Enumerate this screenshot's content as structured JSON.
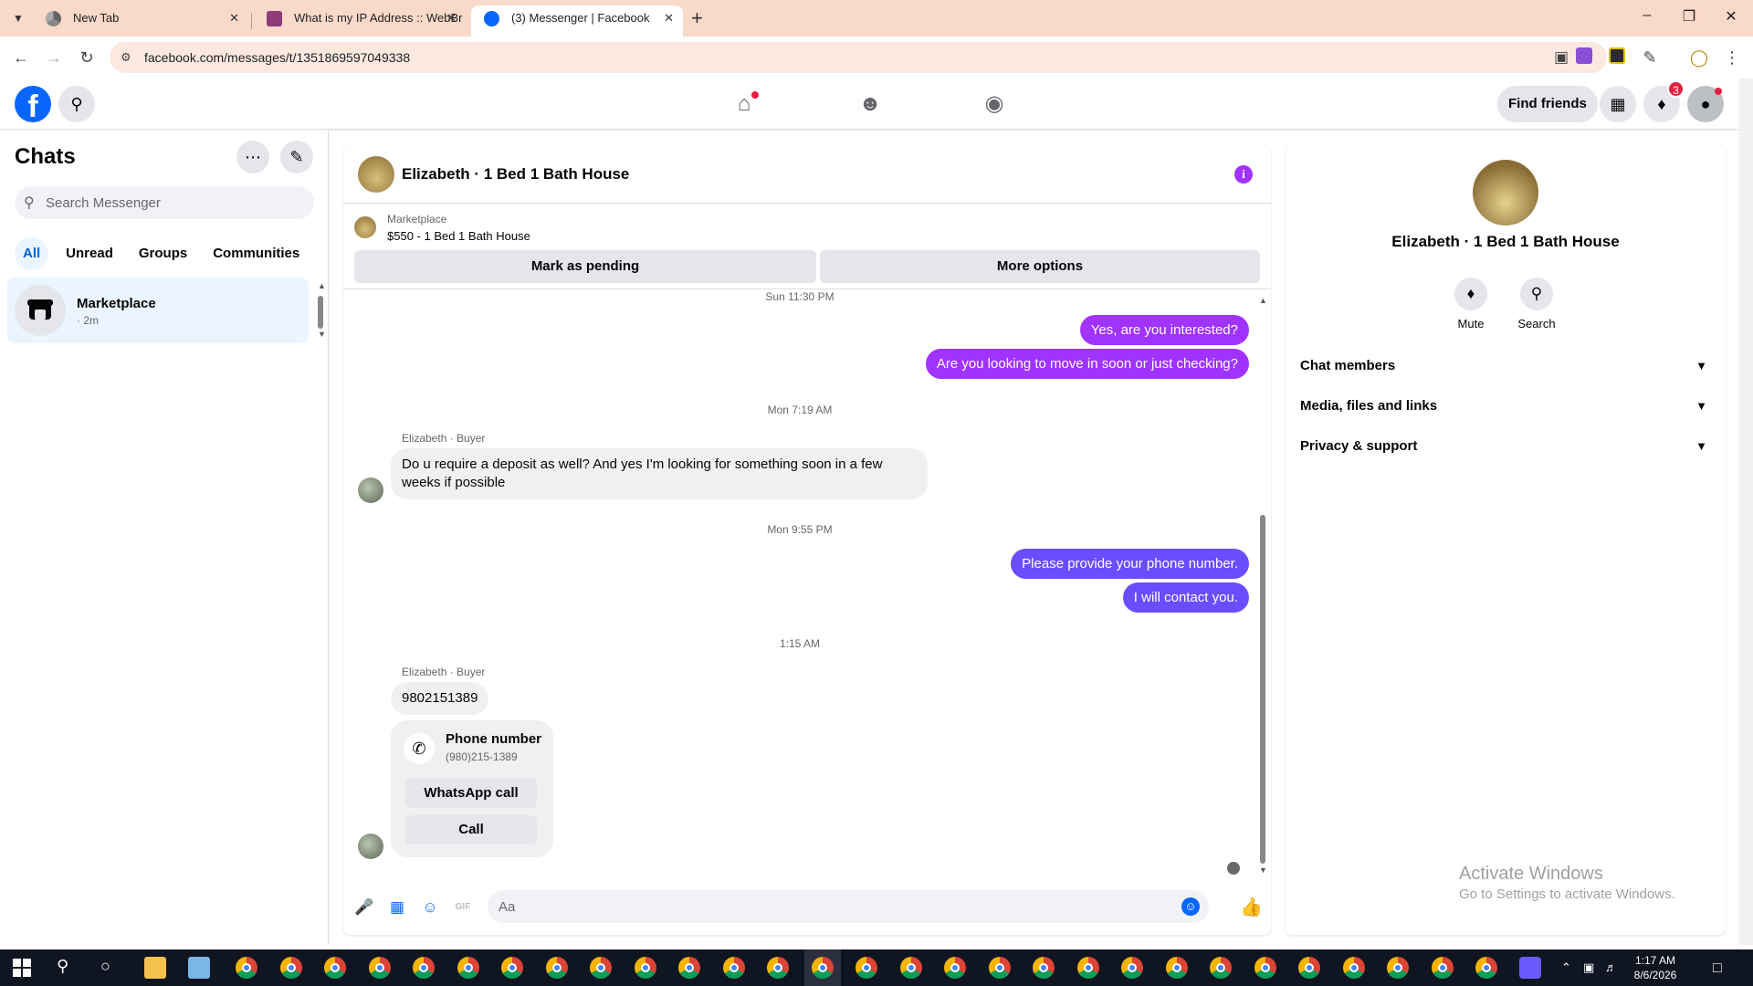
{
  "browser": {
    "tabs": [
      {
        "title": "New Tab",
        "active": false
      },
      {
        "title": "What is my IP Address :: WebBr",
        "active": false
      },
      {
        "title": "(3) Messenger | Facebook",
        "active": true
      }
    ],
    "url": "facebook.com/messages/t/1351869597049338"
  },
  "fb_nav": {
    "find_friends": "Find friends",
    "notifications_count": "3"
  },
  "chats": {
    "title": "Chats",
    "search_placeholder": "Search Messenger",
    "filters": [
      "All",
      "Unread",
      "Groups",
      "Communities"
    ],
    "items": [
      {
        "name": "Marketplace",
        "time": "· 2m"
      }
    ]
  },
  "conversation": {
    "title": "Elizabeth · 1 Bed 1 Bath House",
    "marketplace_label": "Marketplace",
    "listing": "$550 - 1 Bed 1 Bath House",
    "mark_pending": "Mark as pending",
    "more_options": "More options",
    "messages": {
      "ts1": "Sun 11:30 PM",
      "out1": "Yes, are you interested?",
      "out2": "Are you looking to move in soon or just checking?",
      "ts2": "Mon 7:19 AM",
      "sender1": "Elizabeth · Buyer",
      "in1": "Do u require a deposit as well? And yes I'm looking for something soon in a few weeks if possible",
      "ts3": "Mon 9:55 PM",
      "out3": "Please provide your phone number.",
      "out4": "I will contact you.",
      "ts4": "1:15 AM",
      "sender2": "Elizabeth · Buyer",
      "in2": "9802151389",
      "phone_card": {
        "title": "Phone number",
        "number": "(980)215-1389",
        "whatsapp": "WhatsApp call",
        "call": "Call"
      }
    },
    "composer_placeholder": "Aa"
  },
  "info_panel": {
    "name": "Elizabeth · 1 Bed 1 Bath House",
    "actions": [
      "Mute",
      "Search"
    ],
    "sections": [
      "Chat members",
      "Media, files and links",
      "Privacy & support"
    ]
  },
  "watermark": {
    "line1": "Activate Windows",
    "line2": "Go to Settings to activate Windows."
  },
  "taskbar": {
    "time": "1:17 AM",
    "date": "8/6/2026"
  },
  "colors": {
    "fb_blue": "#0866ff",
    "out_bubble": "#a033ff",
    "out_bubble_blue": "#6b4cff",
    "tabbar": "#f9d9c9"
  }
}
